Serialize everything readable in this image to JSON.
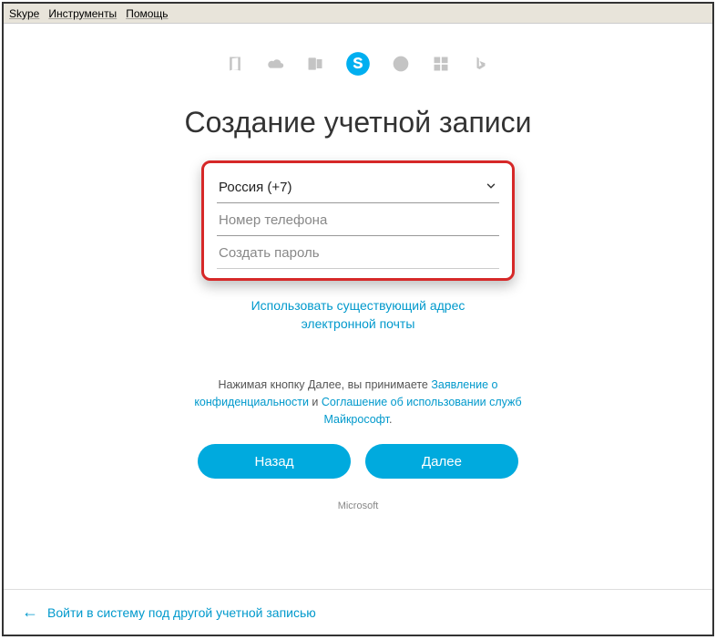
{
  "menu": {
    "skype": "Skype",
    "instruments": "Инструменты",
    "help": "Помощь"
  },
  "title": "Создание учетной записи",
  "form": {
    "country": "Россия (+7)",
    "phone_placeholder": "Номер телефона",
    "password_placeholder": "Создать пароль"
  },
  "use_email_link": "Использовать существующий адрес электронной почты",
  "terms": {
    "prefix": "Нажимая кнопку Далее, вы принимаете ",
    "privacy": "Заявление о конфиденциальности",
    "and": " и ",
    "tos": "Соглашение об использовании служб Майкрософт",
    "suffix": "."
  },
  "buttons": {
    "back": "Назад",
    "next": "Далее"
  },
  "footer": "Microsoft",
  "bottom_link": "Войти в систему под другой учетной записью"
}
